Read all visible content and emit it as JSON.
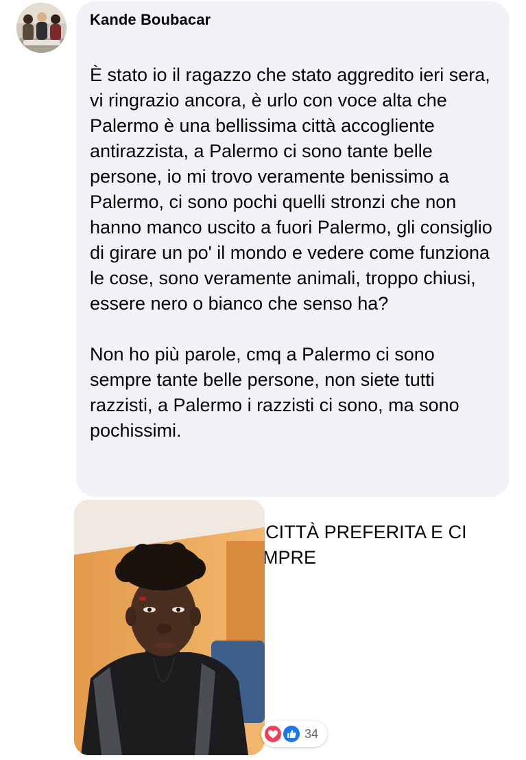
{
  "comment": {
    "author": "Kande Boubacar",
    "paragraphs": [
      "È stato io il ragazzo che stato aggredito ieri sera, vi ringrazio ancora, è urlo con voce alta che Palermo è una bellissima città accogliente antirazzista, a Palermo ci sono tante belle persone, io mi trovo veramente benissimo a Palermo, ci sono pochi quelli stronzi che non hanno manco uscito a fuori Palermo, gli consiglio di girare un po' il mondo e vedere come funziona le cose, sono veramente animali, troppo chiusi, essere nero o bianco che senso ha?",
      "Non ho più parole, cmq a Palermo ci sono sempre tante belle persone, non siete tutti razzisti, a Palermo i razzisti ci sono, ma sono pochissimi.",
      "PALERMO È LA MIA CITTÀ PREFERITA E CI RIMANERÒ PER SEMPRE"
    ]
  },
  "reactions": {
    "icons": [
      "heart-icon",
      "like-icon"
    ],
    "count": "34",
    "heart_color": "#f33e58",
    "like_color": "#1877f2"
  },
  "colors": {
    "bubble_background": "#f0f2f5",
    "text": "#050505",
    "secondary_text": "#65676b"
  }
}
